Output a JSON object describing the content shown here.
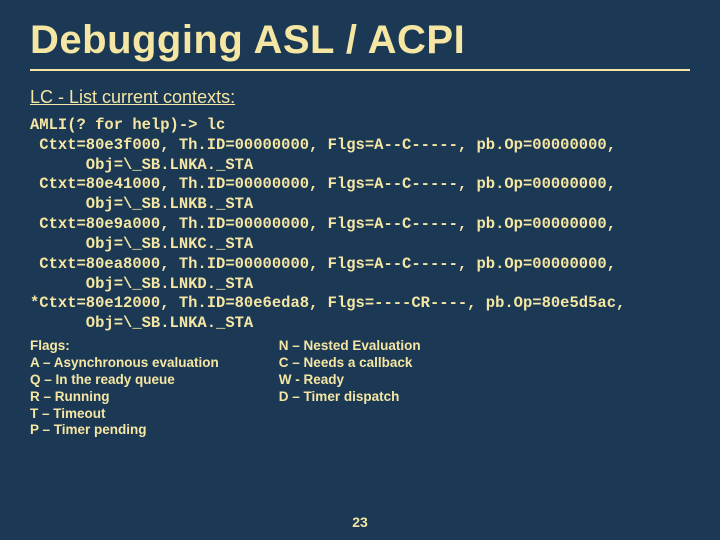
{
  "title": "Debugging ASL / ACPI",
  "subtitle": "LC - List current contexts:",
  "code_lines": [
    "AMLI(? for help)-> lc",
    " Ctxt=80e3f000, Th.ID=00000000, Flgs=A--C-----, pb.Op=00000000,",
    "      Obj=\\_SB.LNKA._STA",
    " Ctxt=80e41000, Th.ID=00000000, Flgs=A--C-----, pb.Op=00000000,",
    "      Obj=\\_SB.LNKB._STA",
    " Ctxt=80e9a000, Th.ID=00000000, Flgs=A--C-----, pb.Op=00000000,",
    "      Obj=\\_SB.LNKC._STA",
    " Ctxt=80ea8000, Th.ID=00000000, Flgs=A--C-----, pb.Op=00000000,",
    "      Obj=\\_SB.LNKD._STA",
    "*Ctxt=80e12000, Th.ID=80e6eda8, Flgs=----CR----, pb.Op=80e5d5ac,",
    "      Obj=\\_SB.LNKA._STA"
  ],
  "flags_header": "Flags:",
  "flags_left": [
    "A – Asynchronous evaluation",
    "Q – In the ready queue",
    "R – Running",
    "T – Timeout",
    "P – Timer pending"
  ],
  "flags_right": [
    "N – Nested Evaluation",
    "C – Needs a callback",
    "W - Ready",
    "D – Timer dispatch"
  ],
  "page_number": "23"
}
